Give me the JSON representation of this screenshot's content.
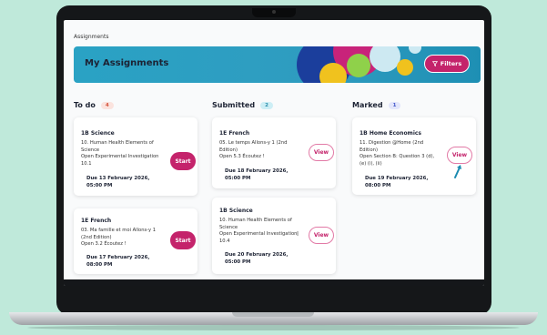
{
  "breadcrumb": "Assignments",
  "banner": {
    "title": "My Assignments",
    "filters_label": "Filters"
  },
  "columns": {
    "todo": {
      "label": "To do",
      "count": "4"
    },
    "submitted": {
      "label": "Submitted",
      "count": "2"
    },
    "marked": {
      "label": "Marked",
      "count": "1"
    }
  },
  "cards": {
    "todo1": {
      "subject": "1B Science",
      "desc": "10. Human Health Elements of\nScience\nOpen Experimental Investigation\n10.1",
      "due": "Due 13 February 2026,\n05:00 PM",
      "action": "Start"
    },
    "todo2": {
      "subject": "1E French",
      "desc": "03. Ma famille et moi Allons-y 1\n(2nd Edition)\nOpen 3.2 Écoutez !",
      "due": "Due 17 February 2026,\n08:00 PM",
      "action": "Start"
    },
    "sub1": {
      "subject": "1E French",
      "desc": "05. Le temps Allons-y 1 (2nd\nEdition)\nOpen 5.3 Écoutez !",
      "due": "Due 18 February 2026,\n05:00 PM",
      "action": "View"
    },
    "sub2": {
      "subject": "1B Science",
      "desc": "10. Human Health Elements of\nScience\nOpen Experimental Investigation\n10.4",
      "due": "Due 20 February 2026,\n05:00 PM",
      "action": "View"
    },
    "mark1": {
      "subject": "1B Home Economics",
      "desc": "11. Digestion @Home (2nd\nEdition)\nOpen Section B: Question 3 (d),\n(e) (i), (ii)",
      "due": "Due 19 February 2026,\n08:00 PM",
      "action": "View"
    }
  },
  "colors": {
    "accent": "#c4236b",
    "banner": "#2aa2c4",
    "background": "#bfe9da"
  }
}
